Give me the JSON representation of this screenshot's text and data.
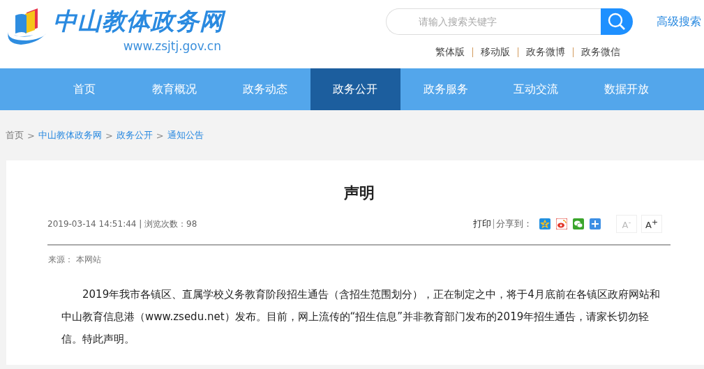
{
  "logo": {
    "title": "中山教体政务网",
    "url": "www.zsjtj.gov.cn"
  },
  "search": {
    "placeholder": "请输入搜索关键字",
    "advanced": "高级搜索"
  },
  "top_links": [
    "繁体版",
    "移动版",
    "政务微博",
    "政务微信"
  ],
  "nav": [
    {
      "label": "首页",
      "selected": false
    },
    {
      "label": "教育概况",
      "selected": false
    },
    {
      "label": "政务动态",
      "selected": false
    },
    {
      "label": "政务公开",
      "selected": true
    },
    {
      "label": "政务服务",
      "selected": false
    },
    {
      "label": "互动交流",
      "selected": false
    },
    {
      "label": "数据开放",
      "selected": false
    }
  ],
  "breadcrumb": [
    {
      "kind": "text",
      "label": "首页"
    },
    {
      "kind": "separator",
      "label": ">"
    },
    {
      "kind": "link",
      "label": "中山教体政务网"
    },
    {
      "kind": "separator",
      "label": ">"
    },
    {
      "kind": "link",
      "label": "政务公开"
    },
    {
      "kind": "separator",
      "label": ">"
    },
    {
      "kind": "link",
      "label": "通知公告"
    }
  ],
  "article": {
    "title": "声明",
    "meta": "2019-03-14 14:51:44 | 浏览次数：98",
    "print": "打印",
    "share_label": "分享到：",
    "share": [
      {
        "kind": "qzone"
      },
      {
        "kind": "weibo"
      },
      {
        "kind": "wechat"
      },
      {
        "kind": "more"
      }
    ],
    "font_buttons": [
      {
        "label": "A$^{-}$",
        "disabled": true
      },
      {
        "label": "A$^{+}$",
        "disabled": false
      }
    ],
    "source": "来源： 本网站",
    "body": "2019年我市各镇区、直属学校义务教育阶段招生通告（含招生范围划分），正在制定之中，将于4月底前在各镇区政府网站和中山教育信息港（www.zsedu.net）发布。目前，网上流传的“招生信息”并非教育部门发布的2019年招生通告，请家长切勿轻信。特此声明。"
  }
}
